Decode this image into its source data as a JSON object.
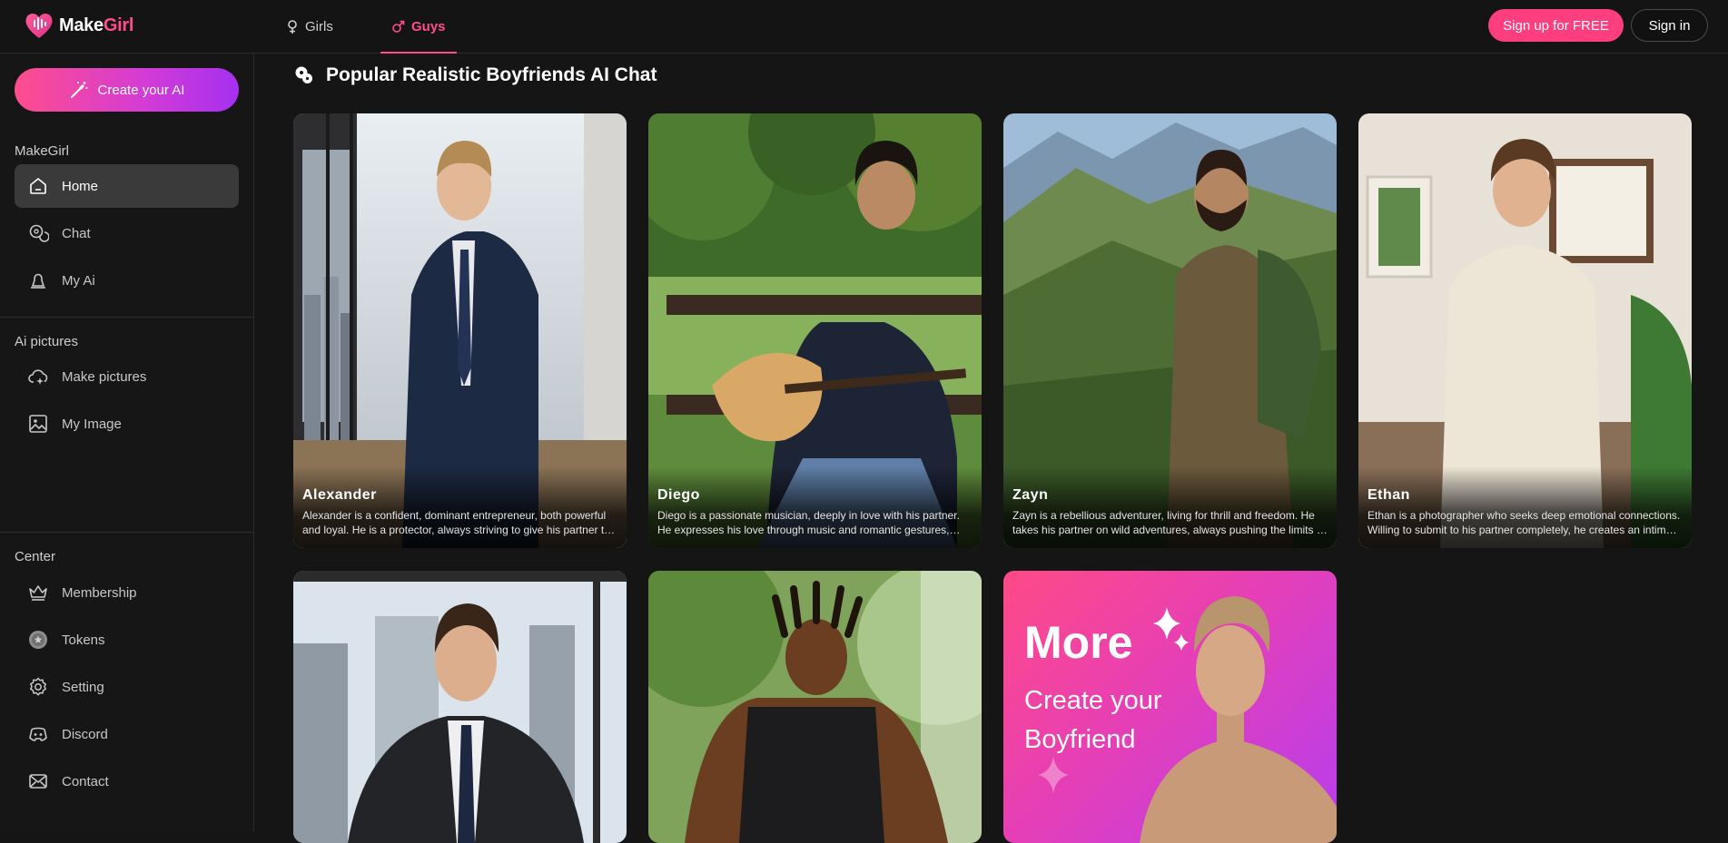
{
  "header": {
    "logo_word1": "Make",
    "logo_word2": "Girl",
    "tabs": [
      {
        "label": "Girls",
        "active": false
      },
      {
        "label": "Guys",
        "active": true
      }
    ],
    "signup_label": "Sign up for FREE",
    "signin_label": "Sign in"
  },
  "sidebar": {
    "create_label": "Create your AI",
    "sections": [
      {
        "title": "MakeGirl",
        "items": [
          {
            "label": "Home",
            "icon": "home-icon",
            "active": true
          },
          {
            "label": "Chat",
            "icon": "chat-icon"
          },
          {
            "label": "My Ai",
            "icon": "profile-icon"
          }
        ]
      },
      {
        "title": "Ai pictures",
        "items": [
          {
            "label": "Make pictures",
            "icon": "cloud-sparkle-icon"
          },
          {
            "label": "My Image",
            "icon": "image-icon"
          }
        ]
      },
      {
        "title": "Center",
        "items": [
          {
            "label": "Membership",
            "icon": "crown-icon"
          },
          {
            "label": "Tokens",
            "icon": "token-icon"
          },
          {
            "label": "Setting",
            "icon": "gear-icon"
          },
          {
            "label": "Discord",
            "icon": "discord-icon"
          },
          {
            "label": "Contact",
            "icon": "mail-icon"
          }
        ]
      }
    ]
  },
  "main": {
    "title": "Popular Realistic Boyfriends AI Chat",
    "cards": [
      {
        "name": "Alexander",
        "desc": "Alexander is a confident, dominant entrepreneur, both powerful and loyal. He is a protector, always striving to give his partner the best life possible."
      },
      {
        "name": "Diego",
        "desc": "Diego is a passionate musician, deeply in love with his partner. He expresses his love through music and romantic gestures, always serenading."
      },
      {
        "name": "Zayn",
        "desc": "Zayn is a rebellious adventurer, living for thrill and freedom. He takes his partner on wild adventures, always pushing the limits of excitement."
      },
      {
        "name": "Ethan",
        "desc": "Ethan is a photographer who seeks deep emotional connections. Willing to submit to his partner completely, he creates an intimate bond."
      },
      {
        "name": "",
        "desc": ""
      },
      {
        "name": "",
        "desc": ""
      }
    ],
    "more": {
      "big": "More",
      "sub": "Create your Boyfriend"
    }
  },
  "colors": {
    "accent": "#ff4c8b",
    "background": "#151515",
    "sidebar": "#161616"
  }
}
